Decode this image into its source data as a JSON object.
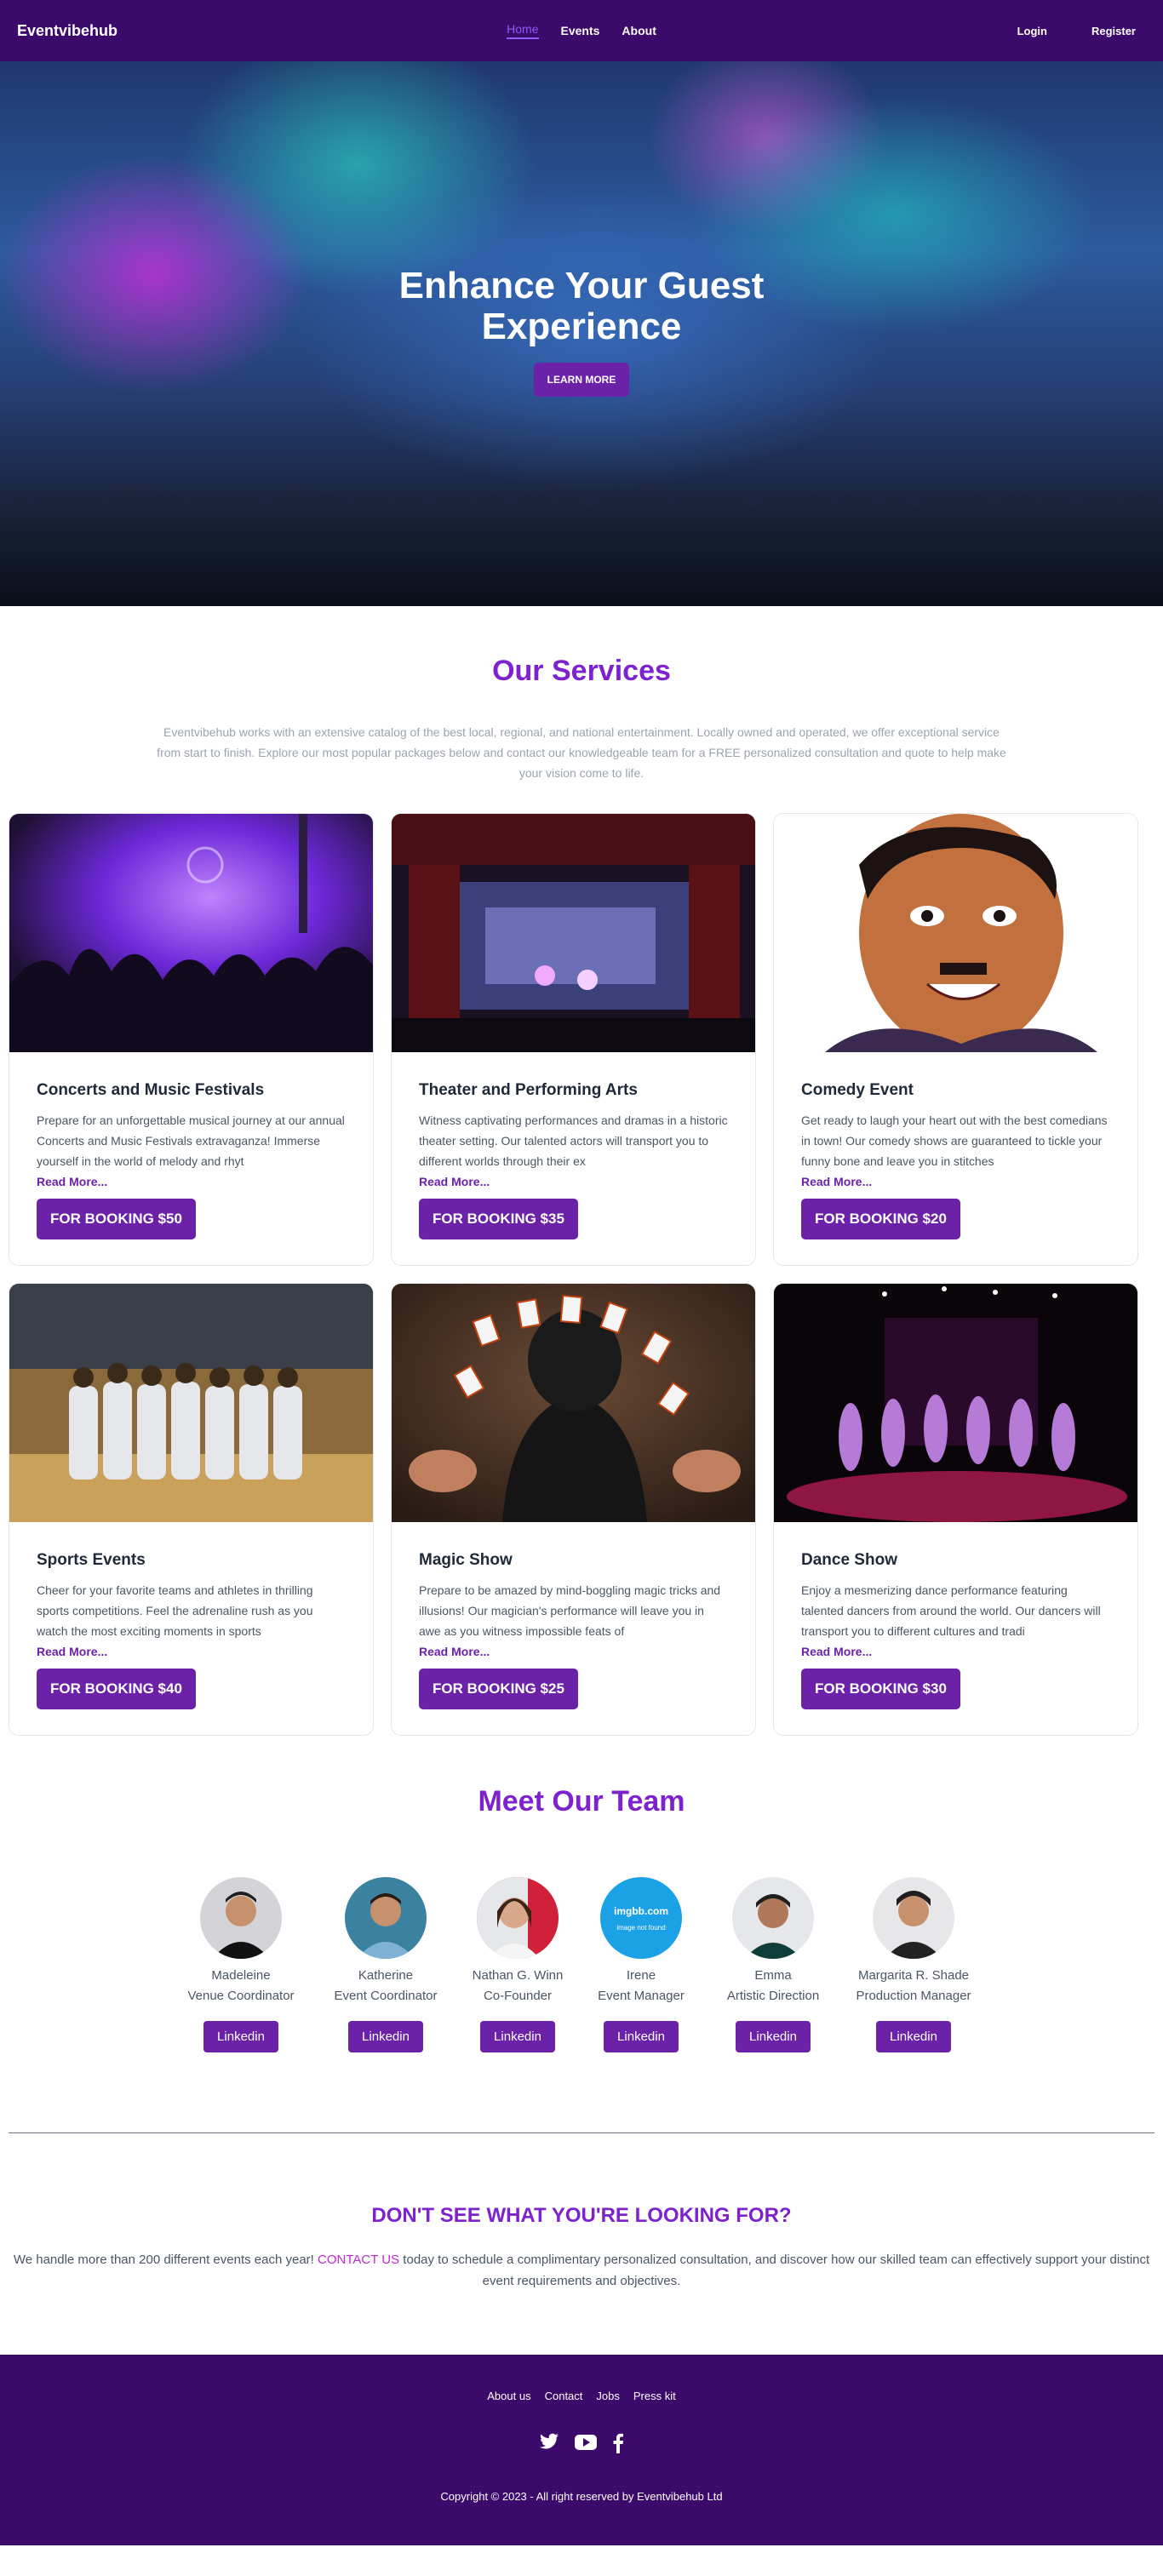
{
  "nav": {
    "brand": "Eventvibehub",
    "links": [
      {
        "label": "Home",
        "active": true
      },
      {
        "label": "Events",
        "active": false
      },
      {
        "label": "About",
        "active": false
      }
    ],
    "login": "Login",
    "register": "Register"
  },
  "hero": {
    "title": "Enhance Your Guest Experience",
    "button": "LEARN MORE"
  },
  "services": {
    "title": "Our Services",
    "description": "Eventvibehub works with an extensive catalog of the best local, regional, and national entertainment. Locally owned and operated, we offer exceptional service from start to finish. Explore our most popular packages below and contact our knowledgeable team for a FREE personalized consultation and quote to help make your vision come to life.",
    "read_more": "Read More...",
    "cards": [
      {
        "title": "Concerts and Music Festivals",
        "text": "Prepare for an unforgettable musical journey at our annual Concerts and Music Festivals extravaganza! Immerse yourself in the world of melody and rhyt",
        "button": "FOR BOOKING $50",
        "image": "concert-photo"
      },
      {
        "title": "Theater and Performing Arts",
        "text": "Witness captivating performances and dramas in a historic theater setting. Our talented actors will transport you to different worlds through their ex",
        "button": "FOR BOOKING $35",
        "image": "theater-photo"
      },
      {
        "title": "Comedy Event",
        "text": "Get ready to laugh your heart out with the best comedians in town! Our comedy shows are guaranteed to tickle your funny bone and leave you in stitches",
        "button": "FOR BOOKING $20",
        "image": "comedian-portrait"
      },
      {
        "title": "Sports Events",
        "text": "Cheer for your favorite teams and athletes in thrilling sports competitions. Feel the adrenaline rush as you watch the most exciting moments in sports",
        "button": "FOR BOOKING $40",
        "image": "basketball-photo"
      },
      {
        "title": "Magic Show",
        "text": "Prepare to be amazed by mind-boggling magic tricks and illusions! Our magician's performance will leave you in awe as you witness impossible feats of",
        "button": "FOR BOOKING $25",
        "image": "magic-cards-photo"
      },
      {
        "title": "Dance Show",
        "text": "Enjoy a mesmerizing dance performance featuring talented dancers from around the world. Our dancers will transport you to different cultures and tradi",
        "button": "FOR BOOKING $30",
        "image": "dance-photo"
      }
    ]
  },
  "team": {
    "title": "Meet Our Team",
    "button": "Linkedin",
    "members": [
      {
        "name": "Madeleine",
        "role": "Venue Coordinator",
        "avatar": "person"
      },
      {
        "name": "Katherine",
        "role": "Event Coordinator",
        "avatar": "person"
      },
      {
        "name": "Nathan G. Winn",
        "role": "Co-Founder",
        "avatar": "person"
      },
      {
        "name": "Irene",
        "role": "Event Manager",
        "avatar": "placeholder",
        "placeholder_title": "imgbb.com",
        "placeholder_sub": "image not found"
      },
      {
        "name": "Emma",
        "role": "Artistic Direction",
        "avatar": "person"
      },
      {
        "name": "Margarita R. Shade",
        "role": "Production Manager",
        "avatar": "person"
      }
    ]
  },
  "cta": {
    "title": "DON'T SEE WHAT YOU'RE LOOKING FOR?",
    "text_before": "We handle more than 200 different events each year! ",
    "link": "CONTACT US",
    "text_after": " today to schedule a complimentary personalized consultation, and discover how our skilled team can effectively support your distinct event requirements and objectives."
  },
  "footer": {
    "links": [
      "About us",
      "Contact",
      "Jobs",
      "Press kit"
    ],
    "socials": [
      "twitter-icon",
      "youtube-icon",
      "facebook-icon"
    ],
    "copyright": "Copyright © 2023 - All right reserved by Eventvibehub Ltd"
  },
  "colors": {
    "brand": "#3c0a6b",
    "accent": "#6b21a8",
    "heading": "#7e22ce"
  }
}
